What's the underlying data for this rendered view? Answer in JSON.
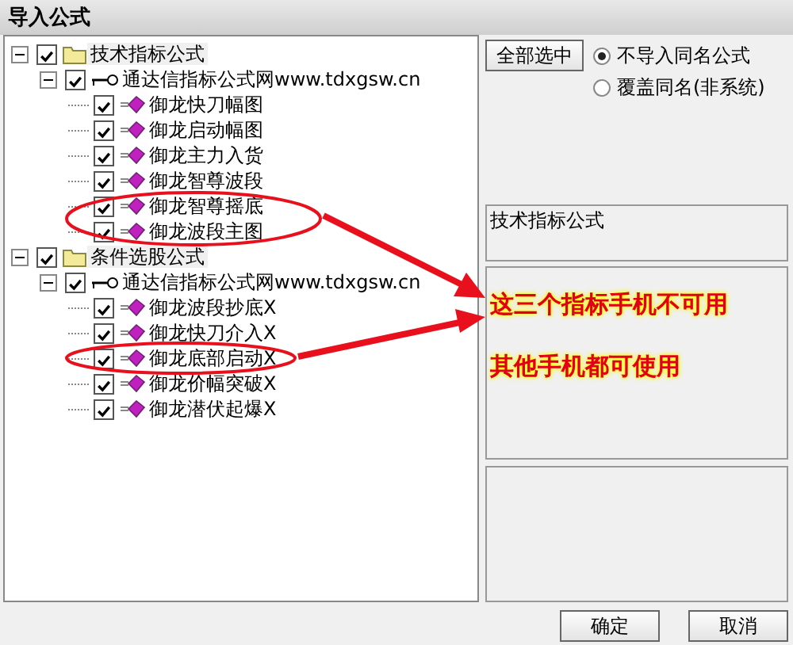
{
  "window": {
    "title": "导入公式"
  },
  "tree": [
    {
      "label": "技术指标公式",
      "kind": "folder",
      "checked": true,
      "expanded": true,
      "children": [
        {
          "label": "通达信指标公式网www.tdxgsw.cn",
          "kind": "key",
          "checked": true,
          "expanded": true,
          "children": [
            {
              "label": "御龙快刀幅图",
              "kind": "formula",
              "checked": true
            },
            {
              "label": "御龙启动幅图",
              "kind": "formula",
              "checked": true
            },
            {
              "label": "御龙主力入货",
              "kind": "formula",
              "checked": true
            },
            {
              "label": "御龙智尊波段",
              "kind": "formula",
              "checked": true
            },
            {
              "label": "御龙智尊摇底",
              "kind": "formula",
              "checked": true
            },
            {
              "label": "御龙波段主图",
              "kind": "formula",
              "checked": true
            }
          ]
        }
      ]
    },
    {
      "label": "条件选股公式",
      "kind": "folder",
      "checked": true,
      "expanded": true,
      "children": [
        {
          "label": "通达信指标公式网www.tdxgsw.cn",
          "kind": "key",
          "checked": true,
          "expanded": true,
          "children": [
            {
              "label": "御龙波段抄底X",
              "kind": "formula",
              "checked": true
            },
            {
              "label": "御龙快刀介入X",
              "kind": "formula",
              "checked": true
            },
            {
              "label": "御龙底部启动X",
              "kind": "formula",
              "checked": true
            },
            {
              "label": "御龙价幅突破X",
              "kind": "formula",
              "checked": true
            },
            {
              "label": "御龙潜伏起爆X",
              "kind": "formula",
              "checked": true
            }
          ]
        }
      ]
    }
  ],
  "select_all_button": "全部选中",
  "options": [
    {
      "label": "不导入同名公式",
      "selected": true
    },
    {
      "label": "覆盖同名(非系统)",
      "selected": false
    }
  ],
  "description": "技术指标公式",
  "annotations": [
    "这三个指标手机不可用",
    "其他手机都可使用"
  ],
  "buttons": [
    "确定",
    "取消"
  ]
}
